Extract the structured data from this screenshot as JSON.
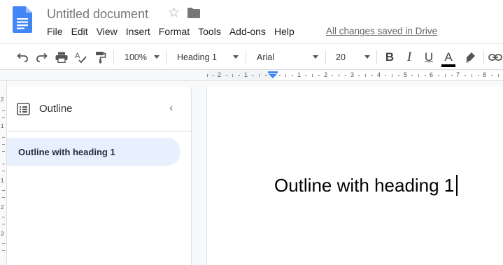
{
  "document": {
    "title": "Untitled document",
    "save_status": "All changes saved in Drive"
  },
  "menu": [
    "File",
    "Edit",
    "View",
    "Insert",
    "Format",
    "Tools",
    "Add-ons",
    "Help"
  ],
  "toolbar": {
    "zoom": "100%",
    "style": "Heading 1",
    "font": "Arial",
    "size": "20",
    "bold": "B",
    "italic": "I",
    "underline": "U",
    "text_color": "A"
  },
  "ruler": {
    "marks": [
      "2",
      "1",
      "1",
      "2",
      "3",
      "4",
      "5",
      "6",
      "7",
      "8"
    ],
    "vmarks": [
      "2",
      "1",
      "1",
      "2",
      "3"
    ]
  },
  "outline": {
    "title": "Outline",
    "items": [
      "Outline with heading 1"
    ]
  },
  "body": {
    "heading": "Outline with heading 1"
  },
  "colors": {
    "brand_blue": "#4285f4",
    "outline_selected": "#e8f0fe"
  }
}
